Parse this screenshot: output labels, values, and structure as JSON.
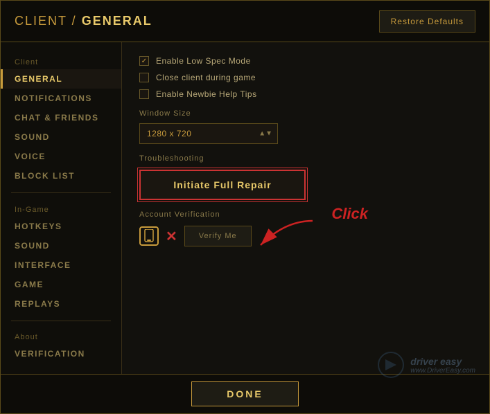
{
  "header": {
    "title_prefix": "CLIENT / ",
    "title_bold": "GENERAL",
    "restore_button": "Restore Defaults"
  },
  "sidebar": {
    "section_client": "Client",
    "items_client": [
      {
        "id": "general",
        "label": "GENERAL",
        "active": true
      },
      {
        "id": "notifications",
        "label": "NOTIFICATIONS",
        "active": false
      },
      {
        "id": "chat-friends",
        "label": "CHAT & FRIENDS",
        "active": false
      },
      {
        "id": "sound",
        "label": "SOUND",
        "active": false
      },
      {
        "id": "voice",
        "label": "VOICE",
        "active": false
      },
      {
        "id": "block-list",
        "label": "BLOCK LIST",
        "active": false
      }
    ],
    "section_ingame": "In-Game",
    "items_ingame": [
      {
        "id": "hotkeys",
        "label": "HOTKEYS",
        "active": false
      },
      {
        "id": "sound-ig",
        "label": "SOUND",
        "active": false
      },
      {
        "id": "interface",
        "label": "INTERFACE",
        "active": false
      },
      {
        "id": "game",
        "label": "GAME",
        "active": false
      },
      {
        "id": "replays",
        "label": "REPLAYS",
        "active": false
      }
    ],
    "section_about": "About",
    "items_about": [
      {
        "id": "verification",
        "label": "VERIFICATION",
        "active": false
      }
    ]
  },
  "content": {
    "checkbox1_label": "Enable Low Spec Mode",
    "checkbox1_checked": true,
    "checkbox2_label": "Close client during game",
    "checkbox2_checked": false,
    "checkbox3_label": "Enable Newbie Help Tips",
    "checkbox3_checked": false,
    "window_size_label": "Window Size",
    "window_size_value": "1280 x 720",
    "troubleshoot_label": "Troubleshooting",
    "repair_button": "Initiate Full Repair",
    "account_label": "Account Verification",
    "verify_button": "Verify Me"
  },
  "annotation": {
    "click_text": "Click"
  },
  "watermark": {
    "brand": "driver easy",
    "url": "www.DriverEasy.com"
  },
  "footer": {
    "done_button": "DONE"
  }
}
